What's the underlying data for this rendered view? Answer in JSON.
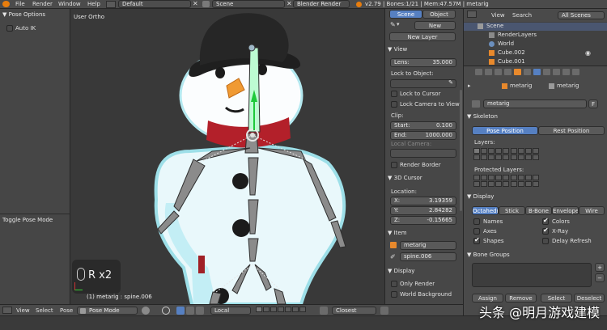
{
  "topbar": {
    "menus": [
      "File",
      "Render",
      "Window",
      "Help"
    ],
    "layout": "Default",
    "scene": "Scene",
    "engine": "Blender Render",
    "stats": "v2.79 | Bones:1/21 | Mem:47.57M | metarig"
  },
  "tool_panel": {
    "title": "Pose Options",
    "auto_ik": "Auto IK",
    "toggle_pose_mode": "Toggle Pose Mode"
  },
  "viewport": {
    "view_label": "User Ortho",
    "key_overlay": "R x2",
    "status_line": "(1) metarig : spine.006"
  },
  "nprops": {
    "tabs": [
      "Scene",
      "Object"
    ],
    "new_label": "New",
    "new_layer": "New Layer",
    "view_section": "View",
    "lens_label": "Lens:",
    "lens_value": "35.000",
    "lock_to_object": "Lock to Object:",
    "lock_to_cursor": "Lock to Cursor",
    "lock_camera_to_view": "Lock Camera to View",
    "clip_label": "Clip:",
    "clip_start_label": "Start:",
    "clip_start_value": "0.100",
    "clip_end_label": "End:",
    "clip_end_value": "1000.000",
    "local_camera": "Local Camera:",
    "render_border": "Render Border",
    "cursor_section": "3D Cursor",
    "location_label": "Location:",
    "x_label": "X:",
    "x_value": "3.19359",
    "y_label": "Y:",
    "y_value": "2.84282",
    "z_label": "Z:",
    "z_value": "-0.15665",
    "item_section": "Item",
    "item_object": "metarig",
    "item_bone": "spine.006",
    "display_section": "Display",
    "only_render": "Only Render",
    "world_background": "World Background"
  },
  "outliner": {
    "view": "View",
    "search": "Search",
    "filter": "All Scenes",
    "items": [
      "Scene",
      "RenderLayers",
      "World",
      "Cube.002",
      "Cube.001"
    ]
  },
  "properties": {
    "breadcrumb": [
      "metarig",
      "metarig"
    ],
    "name_field": "metarig",
    "name_suffix": "F",
    "skeleton": "Skeleton",
    "pose_position": "Pose Position",
    "rest_position": "Rest Position",
    "layers": "Layers:",
    "protected_layers": "Protected Layers:",
    "display": "Display",
    "display_types": [
      "Octahedr",
      "Stick",
      "B-Bone",
      "Envelope",
      "Wire"
    ],
    "names": "Names",
    "colors": "Colors",
    "axes": "Axes",
    "xray": "X-Ray",
    "shapes": "Shapes",
    "delay_refresh": "Delay Refresh",
    "bone_groups": "Bone Groups",
    "assign": "Assign",
    "remove": "Remove",
    "select": "Select",
    "deselect": "Deselect"
  },
  "bottombar": {
    "menus": [
      "View",
      "Select",
      "Pose"
    ],
    "mode": "Pose Mode",
    "orientation": "Local",
    "snap": "Closest"
  },
  "watermark": "头条 @明月游戏建模",
  "colors": {
    "accent": "#5680c2",
    "snow": "#ffffff",
    "scarf": "#b3202a",
    "carrot": "#e8892c",
    "hat": "#1e1e1e",
    "bone": "#8b8b8b"
  }
}
